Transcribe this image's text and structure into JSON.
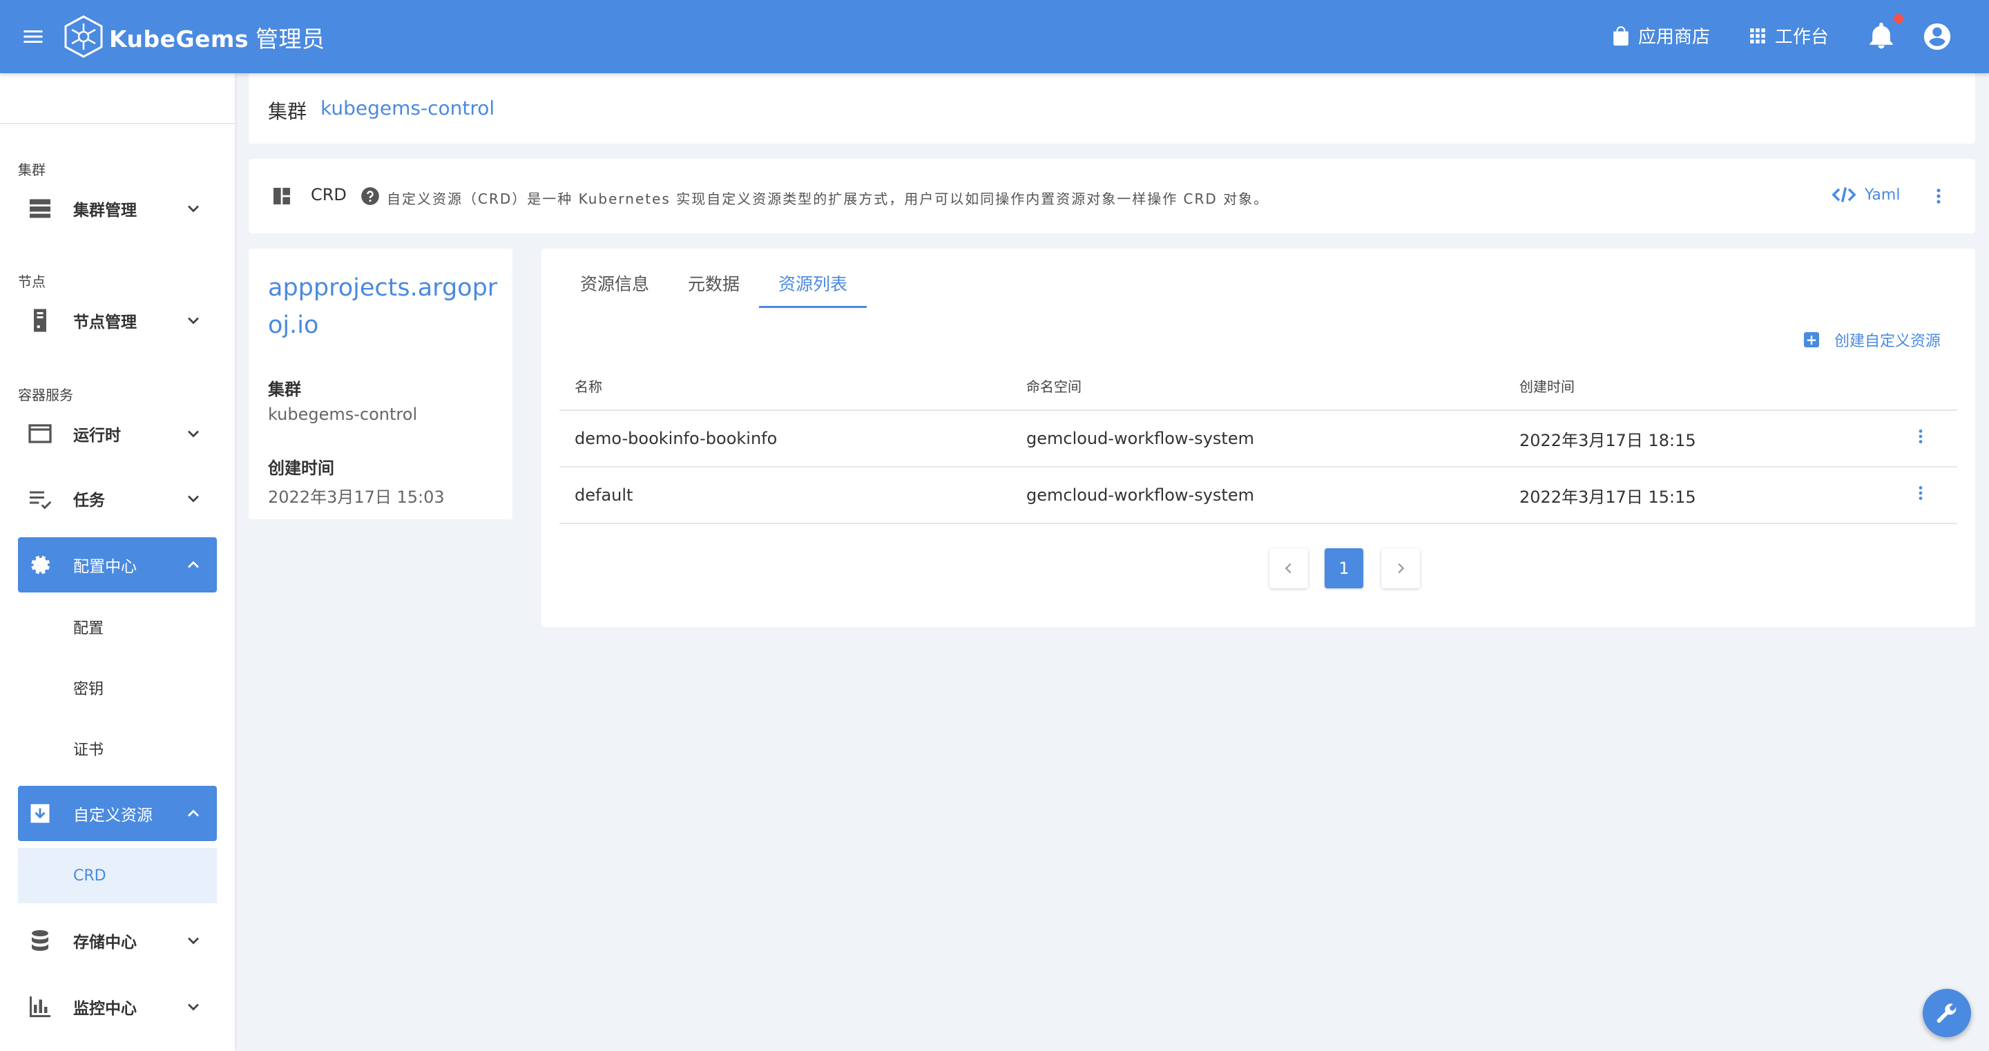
{
  "header": {
    "brand": "KubeGems",
    "role": "管理员",
    "app_store": "应用商店",
    "workbench": "工作台",
    "colors": {
      "bar": "#4a8ae0",
      "badge": "#f2544c"
    }
  },
  "sidebar": {
    "sections": {
      "cluster": "集群",
      "node": "节点",
      "container": "容器服务"
    },
    "items": {
      "cluster_mgmt": "集群管理",
      "node_mgmt": "节点管理",
      "runtime": "运行时",
      "task": "任务",
      "config_center": "配置中心",
      "config": "配置",
      "secret": "密钥",
      "cert": "证书",
      "custom_resource": "自定义资源",
      "crd": "CRD",
      "storage": "存储中心",
      "monitor": "监控中心"
    }
  },
  "cluster_bar": {
    "label": "集群",
    "value": "kubegems-control"
  },
  "crd_bar": {
    "title": "CRD",
    "description": "自定义资源（CRD）是一种 Kubernetes 实现自定义资源类型的扩展方式，用户可以如同操作内置资源对象一样操作 CRD 对象。",
    "yaml": "Yaml"
  },
  "info": {
    "name": "appprojects.argoproj.io",
    "cluster_label": "集群",
    "cluster_value": "kubegems-control",
    "created_label": "创建时间",
    "created_value": "2022年3月17日 15:03"
  },
  "tabs": [
    "资源信息",
    "元数据",
    "资源列表"
  ],
  "create_button": "创建自定义资源",
  "table": {
    "columns": [
      "名称",
      "命名空间",
      "创建时间"
    ],
    "rows": [
      [
        "demo-bookinfo-bookinfo",
        "gemcloud-workflow-system",
        "2022年3月17日 18:15"
      ],
      [
        "default",
        "gemcloud-workflow-system",
        "2022年3月17日 15:15"
      ]
    ]
  },
  "pagination": {
    "current": "1"
  }
}
